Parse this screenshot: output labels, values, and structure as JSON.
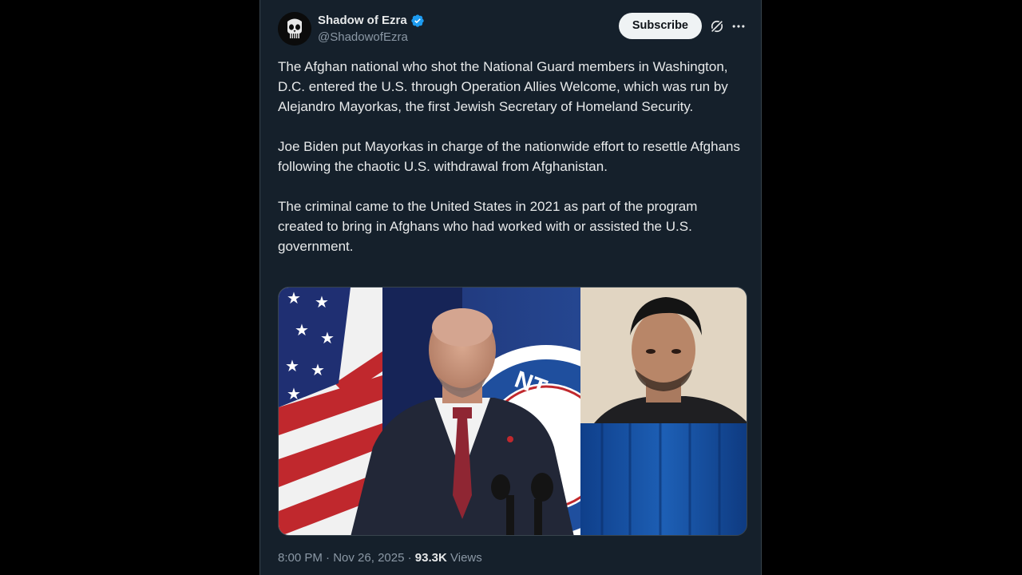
{
  "author": {
    "display_name": "Shadow of Ezra",
    "handle": "@ShadowofEzra",
    "verified": true,
    "avatar_icon": "punisher-skull-icon"
  },
  "actions": {
    "subscribe_label": "Subscribe",
    "grok_icon": "grok-icon",
    "more_icon": "more-options-icon"
  },
  "tweet": {
    "paragraphs": [
      "The Afghan national who shot the National Guard members in Washington, D.C. entered the U.S. through Operation Allies Welcome, which was run by Alejandro Mayorkas, the first Jewish Secretary of Homeland Security.",
      "Joe Biden put Mayorkas in charge of the nationwide effort to resettle Afghans following the chaotic U.S. withdrawal from Afghanistan.",
      "The criminal came to the United States in 2021 as part of the program created to bring in Afghans who had worked with or assisted the U.S. government."
    ]
  },
  "meta": {
    "time": "8:00 PM",
    "separator": "·",
    "date": "Nov 26, 2025",
    "views_count": "93.3K",
    "views_label": "Views"
  },
  "colors": {
    "background": "#15202b",
    "text": "#e7e9ea",
    "muted": "#8b98a5",
    "verified_blue": "#1d9bf0"
  }
}
